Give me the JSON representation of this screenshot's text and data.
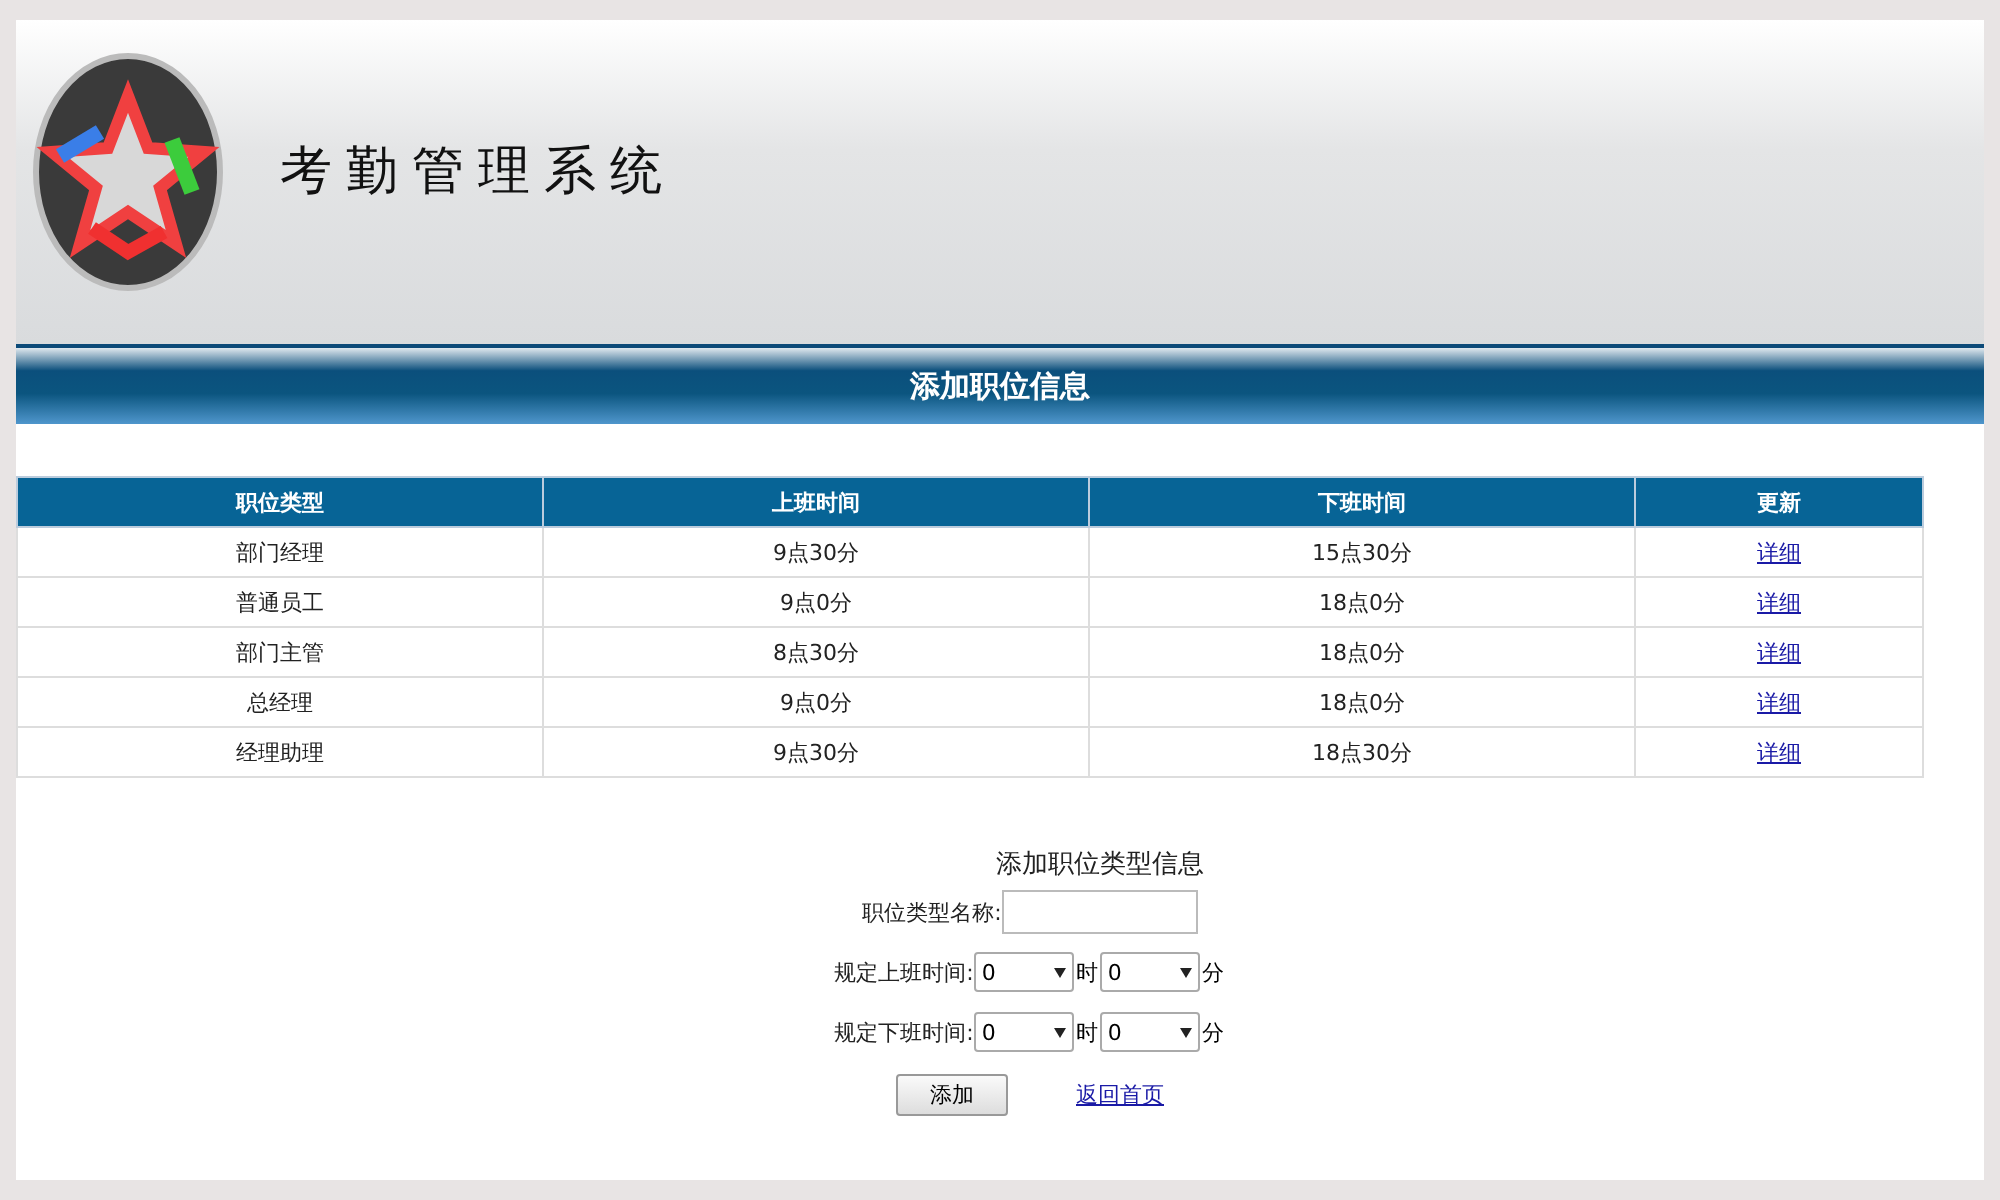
{
  "header": {
    "title": "考勤管理系统"
  },
  "banner": {
    "title": "添加职位信息"
  },
  "table": {
    "columns": [
      "职位类型",
      "上班时间",
      "下班时间",
      "更新"
    ],
    "rows": [
      {
        "type": "部门经理",
        "start": "9点30分",
        "end": "15点30分",
        "link": "详细"
      },
      {
        "type": "普通员工",
        "start": "9点0分",
        "end": "18点0分",
        "link": "详细"
      },
      {
        "type": "部门主管",
        "start": "8点30分",
        "end": "18点0分",
        "link": "详细"
      },
      {
        "type": "总经理",
        "start": "9点0分",
        "end": "18点0分",
        "link": "详细"
      },
      {
        "type": "经理助理",
        "start": "9点30分",
        "end": "18点30分",
        "link": "详细"
      }
    ]
  },
  "form": {
    "title": "添加职位类型信息",
    "name_label": "职位类型名称:",
    "times": [
      {
        "label": "规定上班时间:",
        "hour": "0",
        "hour_unit": "时",
        "minute": "0",
        "minute_unit": "分"
      },
      {
        "label": "规定下班时间:",
        "hour": "0",
        "hour_unit": "时",
        "minute": "0",
        "minute_unit": "分"
      }
    ],
    "submit": "添加",
    "home_link": "返回首页"
  }
}
